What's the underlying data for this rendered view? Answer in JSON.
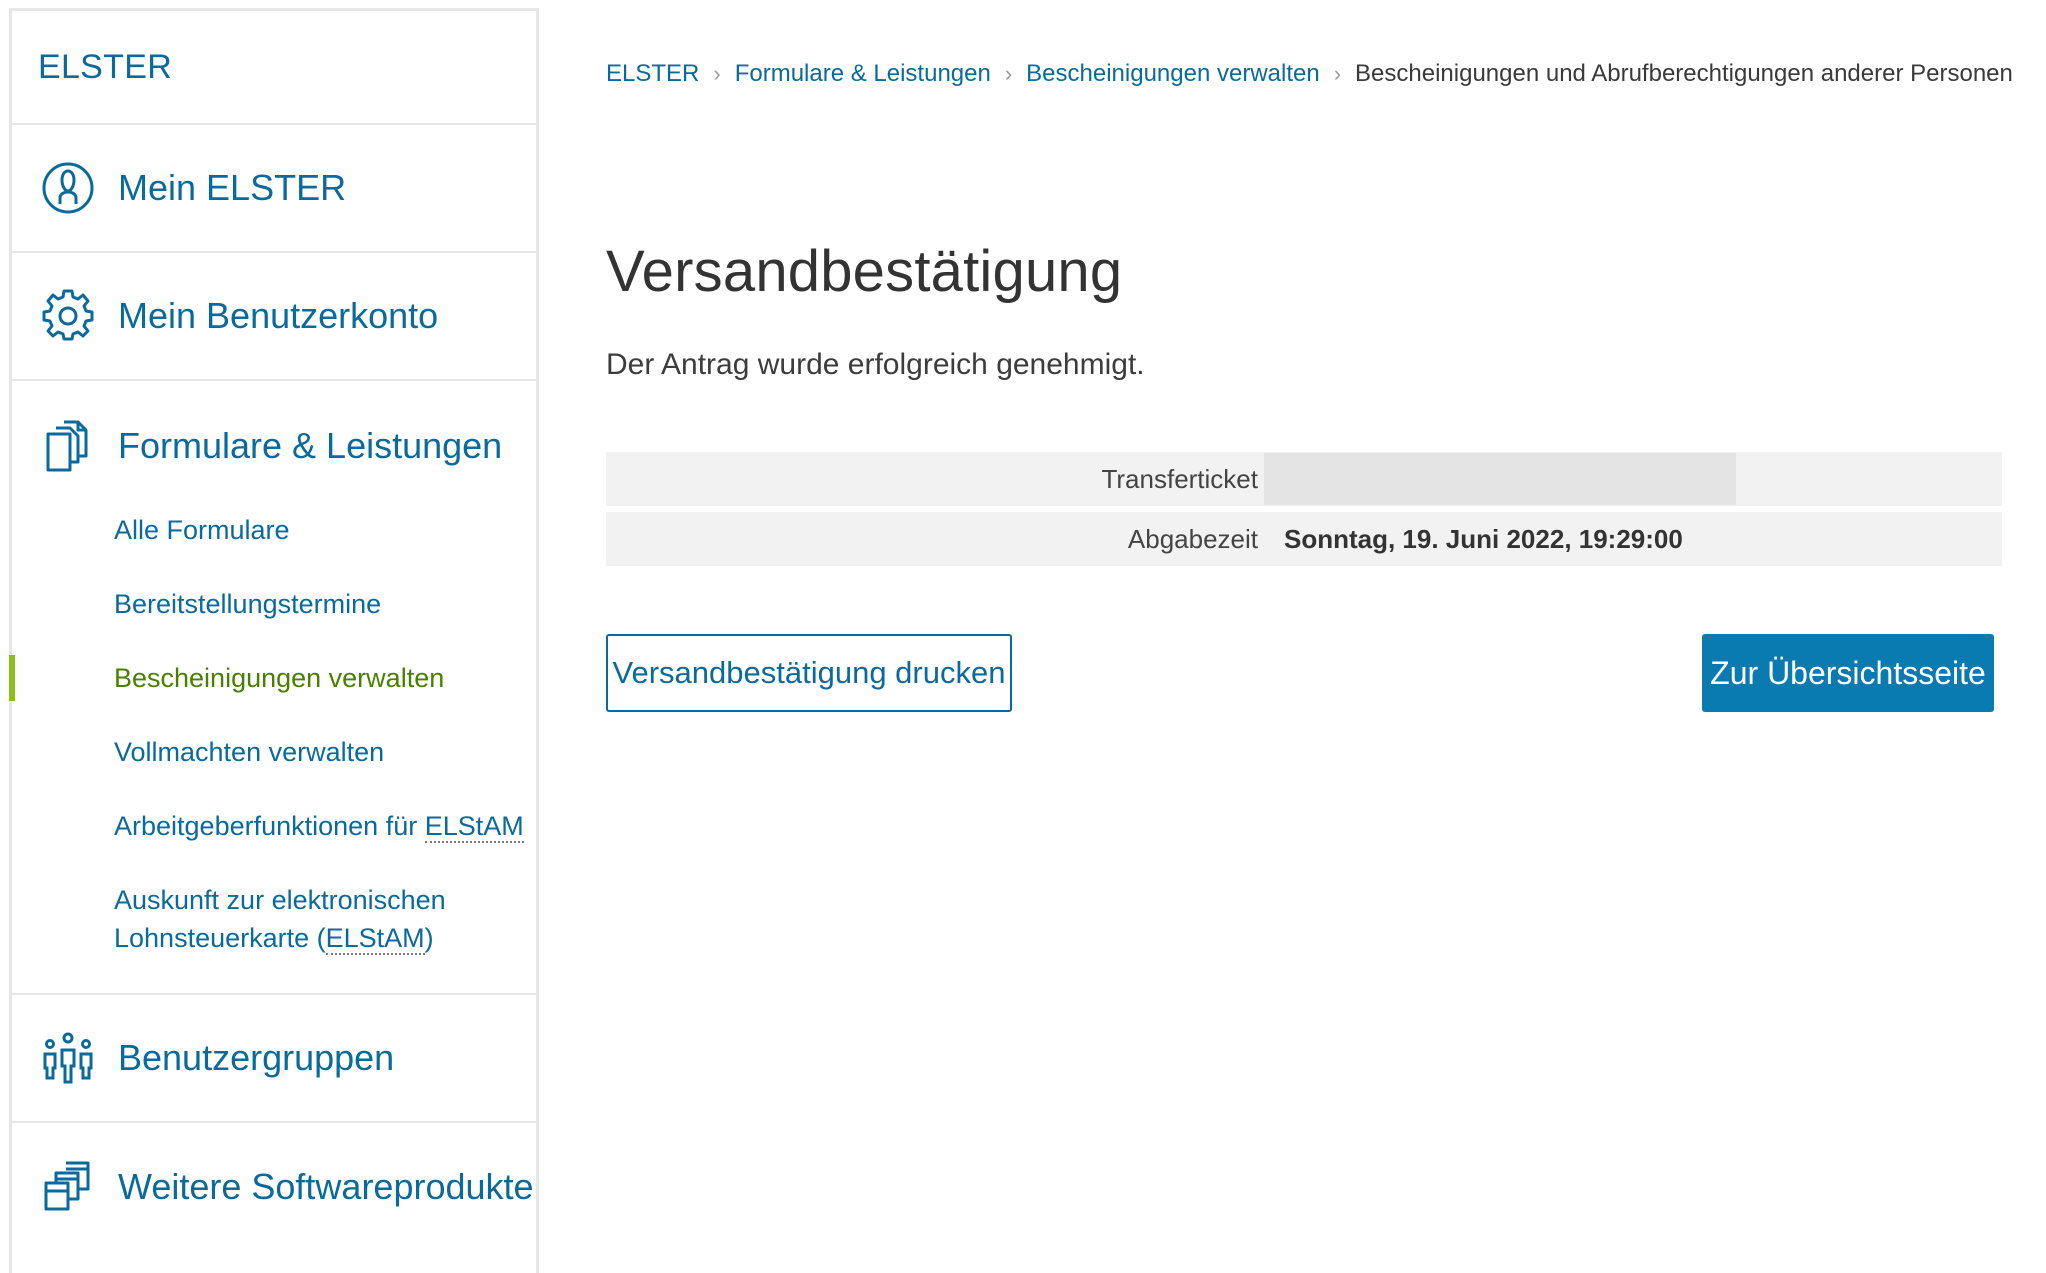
{
  "sidebar": {
    "brand": "ELSTER",
    "sections": [
      {
        "label": "Mein ELSTER",
        "icon": "user-circle-icon"
      },
      {
        "label": "Mein Benutzerkonto",
        "icon": "gear-icon"
      },
      {
        "label": "Formulare & Leistungen",
        "icon": "documents-icon"
      },
      {
        "label": "Benutzergruppen",
        "icon": "user-group-icon"
      },
      {
        "label": "Weitere Softwareprodukte",
        "icon": "external-windows-icon"
      }
    ],
    "sub_items": [
      {
        "label": "Alle Formulare"
      },
      {
        "label": "Bereitstellungstermine"
      },
      {
        "label": "Bescheinigungen verwalten",
        "active": true
      },
      {
        "label": "Vollmachten verwalten"
      },
      {
        "label_prefix": "Arbeitgeberfunktionen für ",
        "label_abbr": "ELStAM"
      },
      {
        "label_line1": "Auskunft zur elektronischen",
        "label_line2_prefix": "Lohnsteuerkarte (",
        "label_abbr": "ELStAM",
        "label_suffix": ")"
      }
    ],
    "accent_color": "#8cbd1f"
  },
  "breadcrumb": {
    "items": [
      "ELSTER",
      "Formulare & Leistungen",
      "Bescheinigungen verwalten"
    ],
    "separator": "›",
    "current": "Bescheinigungen und Abrufberechtigungen anderer Personen"
  },
  "main": {
    "title": "Versandbestätigung",
    "message": "Der Antrag wurde erfolgreich genehmigt.",
    "rows": [
      {
        "label": "Transferticket",
        "value": ""
      },
      {
        "label": "Abgabezeit",
        "value": "Sonntag, 19. Juni 2022, 19:29:00"
      }
    ],
    "print_button": "Versandbestätigung drucken",
    "overview_button": "Zur Übersichtsseite"
  },
  "colors": {
    "link": "#0a6a9c",
    "primary": "#0a7bb0",
    "active": "#4a8000"
  }
}
